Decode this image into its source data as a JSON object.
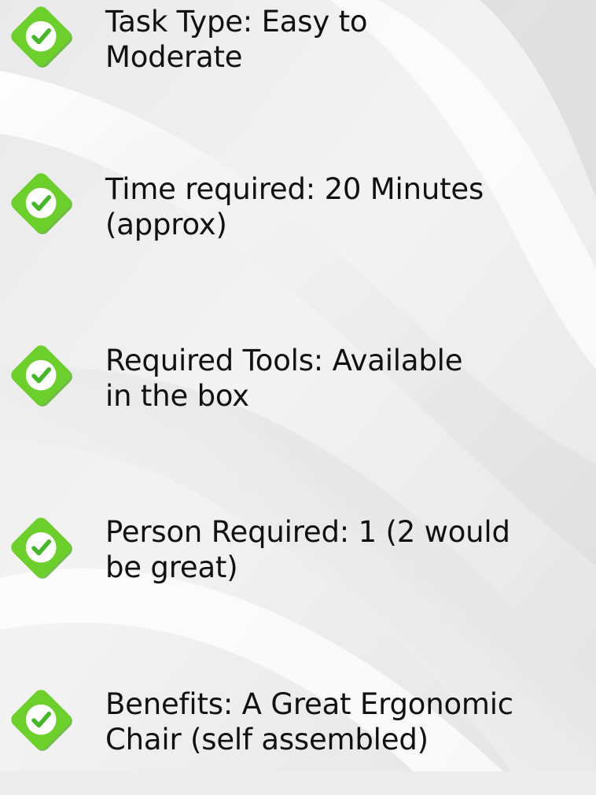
{
  "items": [
    {
      "label": "Task Type: Easy to Moderate",
      "line1": "Task Type: Easy to",
      "line2": "Moderate",
      "icon": "check-diamond-icon"
    },
    {
      "label": "Time required: 20 Minutes (approx)",
      "line1": "Time required: 20 Minutes",
      "line2": "(approx)",
      "icon": "check-diamond-icon"
    },
    {
      "label": "Required Tools: Available in the box",
      "line1": "Required Tools: Available",
      "line2": "in the box",
      "icon": "check-diamond-icon"
    },
    {
      "label": "Person Required: 1 (2 would be great)",
      "line1": "Person Required: 1 (2 would",
      "line2": "be great)",
      "icon": "check-diamond-icon"
    },
    {
      "label": "Benefits: A Great Ergonomic Chair (self assembled)",
      "line1": "Benefits: A Great Ergonomic",
      "line2": "Chair (self assembled)",
      "icon": "check-diamond-icon"
    }
  ],
  "colors": {
    "icon_green": "#6ccf2c",
    "icon_green_dark": "#48a61b",
    "check_white": "#ffffff",
    "check_green": "#46b72a",
    "text": "#111111",
    "background": "#ededed"
  }
}
